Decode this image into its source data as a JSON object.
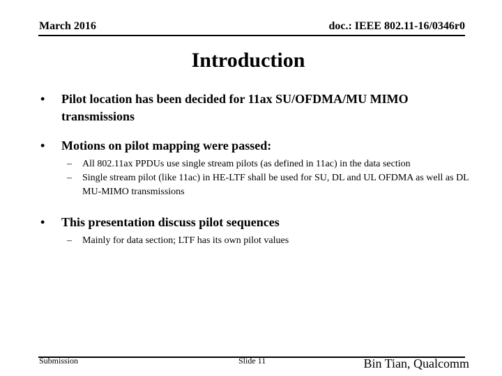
{
  "header": {
    "date": "March 2016",
    "doc_id": "doc.: IEEE 802.11-16/0346r0"
  },
  "title": "Introduction",
  "bullets": [
    {
      "text": "Pilot location has been decided for 11ax SU/OFDMA/MU MIMO transmissions",
      "subs": []
    },
    {
      "text": "Motions on pilot mapping were passed:",
      "subs": [
        "All 802.11ax PPDUs use single stream pilots (as defined in 11ac) in the data section",
        "Single stream pilot (like 11ac) in HE-LTF shall be used for SU,  DL and UL OFDMA as well as DL MU-MIMO transmissions"
      ]
    },
    {
      "text": "This presentation discuss pilot sequences",
      "subs": [
        "Mainly for data section; LTF has its own pilot values"
      ]
    }
  ],
  "symbols": {
    "bullet": "•",
    "dash": "–"
  },
  "footer": {
    "submission": "Submission",
    "slide": "Slide 11",
    "author": "Bin Tian, Qualcomm"
  }
}
